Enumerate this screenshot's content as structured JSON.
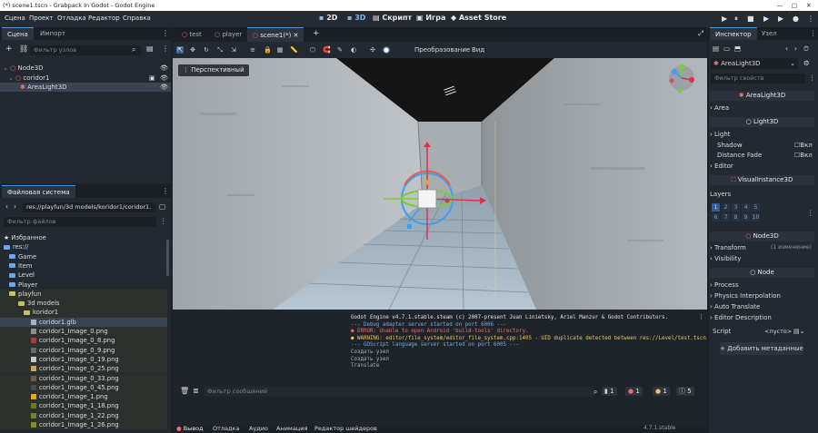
{
  "window": {
    "title": "(*) scene1.tscn - Grabpack In Godot - Godot Engine"
  },
  "menu": [
    "Сцена",
    "Проект",
    "Отладка",
    "Редактор",
    "Справка"
  ],
  "workspaces": [
    "2D",
    "3D",
    "Скрипт",
    "Игра",
    "Asset Store"
  ],
  "scene_dock": {
    "tabs": [
      "Сцена",
      "Импорт"
    ],
    "filter_placeholder": "Фильтр узлов",
    "nodes": [
      "Node3D",
      "coridor1",
      "AreaLight3D"
    ]
  },
  "filesystem": {
    "title": "Файловая система",
    "path": "res://playfun/3d models/koridor1/coridor1.",
    "filter_placeholder": "Фильтр файлов",
    "items": [
      {
        "label": "Избранное",
        "kind": "star"
      },
      {
        "label": "res://",
        "kind": "folder"
      },
      {
        "label": "Game",
        "kind": "folder"
      },
      {
        "label": "Item",
        "kind": "folder"
      },
      {
        "label": "Level",
        "kind": "folder"
      },
      {
        "label": "Player",
        "kind": "folder"
      },
      {
        "label": "playfun",
        "kind": "folder"
      },
      {
        "label": "3d models",
        "kind": "folder"
      },
      {
        "label": "koridor1",
        "kind": "folder"
      },
      {
        "label": "coridor1.glb",
        "kind": "file"
      },
      {
        "label": "coridor1_Image_0.png",
        "kind": "image"
      },
      {
        "label": "coridor1_Image_0_8.png",
        "kind": "image"
      },
      {
        "label": "coridor1_Image_0_9.png",
        "kind": "image"
      },
      {
        "label": "coridor1_Image_0_19.png",
        "kind": "image"
      },
      {
        "label": "coridor1_Image_0_25.png",
        "kind": "image"
      },
      {
        "label": "coridor1_Image_0_33.png",
        "kind": "image"
      },
      {
        "label": "coridor1_Image_0_45.png",
        "kind": "image"
      },
      {
        "label": "coridor1_Image_1.png",
        "kind": "image"
      },
      {
        "label": "coridor1_Image_1_18.png",
        "kind": "image"
      },
      {
        "label": "coridor1_Image_1_22.png",
        "kind": "image"
      },
      {
        "label": "coridor1_Image_1_26.png",
        "kind": "image"
      }
    ]
  },
  "editor_tabs": [
    "test",
    "player",
    "scene1(*)"
  ],
  "viewport": {
    "toolbar": {
      "transform": "Преобразование",
      "view": "Вид"
    },
    "perspective_label": "Перспективный"
  },
  "output": {
    "lines": [
      {
        "text": "Godot Engine v4.7.1.stable.steam (c) 2007-present Juan Linietsky, Ariel Manzur & Godot Contributors.",
        "color": "#e4e6ea"
      },
      {
        "text": "--- Debug adapter server started on port 6006 ---",
        "color": "#7aa8d8"
      },
      {
        "text": "● ERROR: Unable to open Android 'build-tools' directory.",
        "color": "#f06a6a"
      },
      {
        "text": "● WARNING: editor/file_system/editor_file_system.cpp:1405 - UID duplicate detected between res://Level/test.tscn and res://Level/empty.tscn.",
        "color": "#e8c65a"
      },
      {
        "text": "--- GDScript language server started on port 6005 ---",
        "color": "#7aa8d8"
      },
      {
        "text": "Создать узел",
        "color": "#a8adb5"
      },
      {
        "text": "Создать узел",
        "color": "#a8adb5"
      },
      {
        "text": "Translate",
        "color": "#a8adb5"
      }
    ],
    "filter_placeholder": "Фильтр сообщений",
    "counts": [
      "1",
      "1",
      "1",
      "5"
    ],
    "bottom_tabs": [
      "Вывод",
      "Отладка",
      "Аудио",
      "Анимация",
      "Редактор шейдеров"
    ],
    "version": "4.7.1.stable"
  },
  "inspector": {
    "tabs": [
      "Инспектор",
      "Узел"
    ],
    "node_name": "AreaLight3D",
    "filter_placeholder": "Фильтр свойств",
    "sections": [
      {
        "header": "AreaLight3D",
        "rows": [
          {
            "label": "Area"
          }
        ]
      },
      {
        "header": "Light3D",
        "rows": [
          {
            "label": "Light"
          },
          {
            "label": "Shadow",
            "value": "Вкл"
          },
          {
            "label": "Distance Fade",
            "value": "Вкл"
          },
          {
            "label": "Editor"
          }
        ]
      },
      {
        "header": "VisualInstance3D",
        "rows": [
          {
            "label": "Layers"
          }
        ]
      },
      {
        "header": "Node3D",
        "rows": [
          {
            "label": "Transform",
            "value": "(1 изменение)"
          },
          {
            "label": "Visibility"
          }
        ]
      },
      {
        "header": "Node",
        "rows": [
          {
            "label": "Process"
          },
          {
            "label": "Physics Interpolation"
          },
          {
            "label": "Auto Translate"
          },
          {
            "label": "Editor Description"
          },
          {
            "label": "Script",
            "value": "<пусто>"
          }
        ]
      }
    ],
    "layers": [
      "1",
      "2",
      "3",
      "4",
      "5",
      "6",
      "7",
      "8",
      "9",
      "10"
    ],
    "add_meta": "Добавить метаданные"
  }
}
